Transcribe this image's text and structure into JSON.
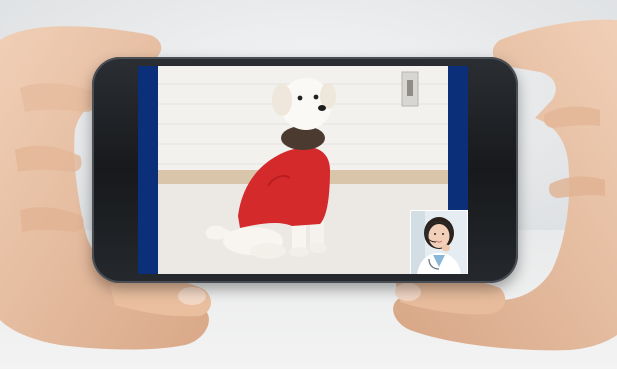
{
  "scene": {
    "icons": {
      "left_hand": "left-hand-icon",
      "right_hand": "right-hand-icon",
      "phone": "smartphone-icon",
      "dog": "dog-icon",
      "doctor": "doctor-with-headset-icon",
      "wall_switch": "wall-switch-icon"
    },
    "colors": {
      "screen_bars": "#0b2f78",
      "dog_sweater": "#d42a2c",
      "dog_collar": "#4a3a30",
      "phone_body": "#1c1e22",
      "skin": "#e9c1a4"
    }
  }
}
